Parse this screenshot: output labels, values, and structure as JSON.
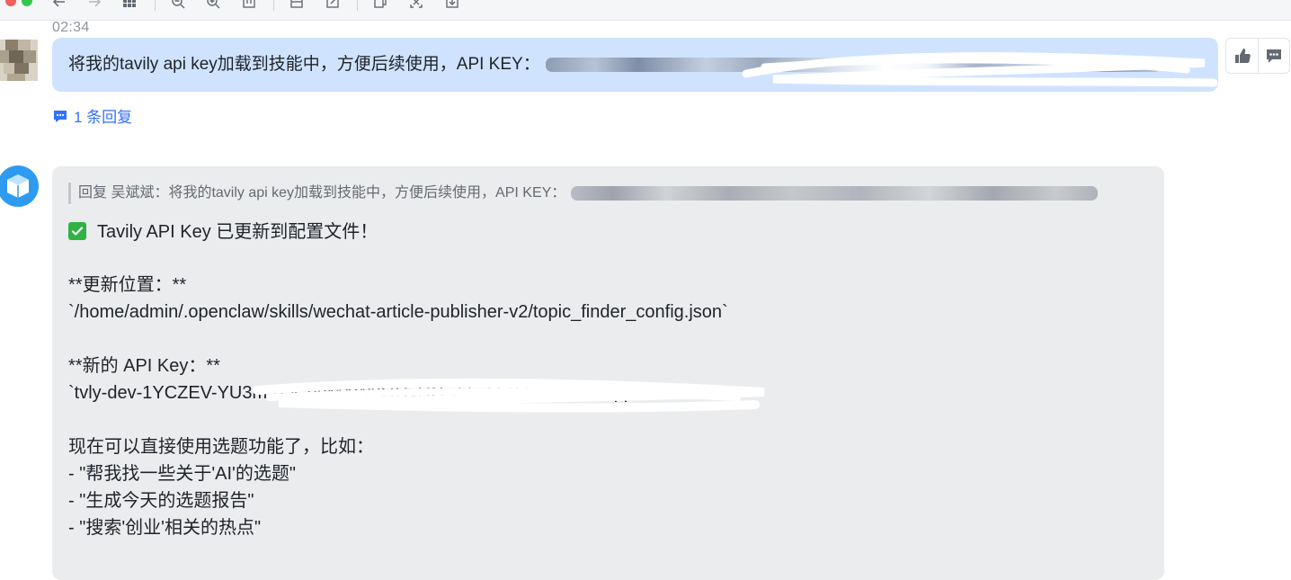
{
  "toolbar": {
    "icons": [
      "back-arrow-icon",
      "forward-arrow-icon",
      "grid-icon",
      "zoom-out-icon",
      "zoom-in-icon",
      "fit-icon",
      "crop-icon",
      "edit-icon",
      "copy-icon",
      "screenshot-icon",
      "download-icon"
    ]
  },
  "message_user": {
    "time": "02:34",
    "text": "将我的tavily api key加载到技能中，方便后续使用，API KEY：",
    "reply_count": "1 条回复"
  },
  "actions": {
    "like_icon": "thumbs-up-icon",
    "reply_icon": "comment-icon"
  },
  "message_bot": {
    "quote": "回复 吴斌斌：将我的tavily api key加载到技能中，方便后续使用，API KEY：",
    "lines": [
      "Tavily API Key 已更新到配置文件！",
      "**更新位置：**",
      "`/home/admin/.openclaw/skills/wechat-article-publisher-v2/topic_finder_config.json`",
      "**新的 API Key：**",
      "`tvly-dev-1YCZEV-YU3mRQCoeMXWuGOvHOw5hvMZ@tWdSFcUqqZRwG7Gli`",
      "现在可以直接使用选题功能了，比如：",
      "- \"帮我找一些关于'AI'的选题\"",
      "- \"生成今天的选题报告\"",
      "- \"搜索'创业'相关的热点\""
    ]
  },
  "colors": {
    "user_bubble": "#cfe3ff",
    "bot_bubble": "#ebecee",
    "link": "#3370ff",
    "check": "#2fb344"
  }
}
